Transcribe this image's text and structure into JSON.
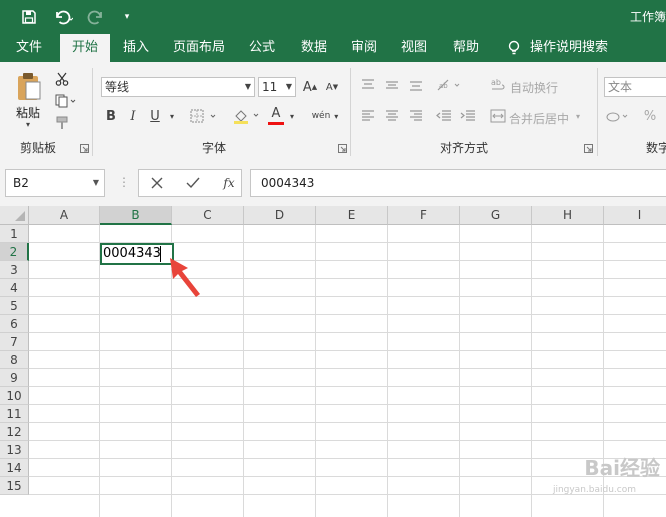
{
  "window": {
    "title": "工作簿"
  },
  "ribbon_tabs": [
    "文件",
    "开始",
    "插入",
    "页面布局",
    "公式",
    "数据",
    "审阅",
    "视图",
    "帮助",
    "操作说明搜索"
  ],
  "clipboard": {
    "paste_label": "粘贴",
    "group_label": "剪贴板"
  },
  "font_group": {
    "font_name": "等线",
    "font_size": "11",
    "bold": "B",
    "italic": "I",
    "underline": "U",
    "font_color_glyph": "A",
    "phonetic_glyph": "wén",
    "group_label": "字体"
  },
  "alignment_group": {
    "wrap_text": "自动换行",
    "merge_center": "合并后居中",
    "group_label": "对齐方式"
  },
  "number_group": {
    "format": "文本",
    "group_label": "数字"
  },
  "formula_bar": {
    "name_box": "B2",
    "fx": "fx",
    "content": "0004343"
  },
  "columns": [
    "A",
    "B",
    "C",
    "D",
    "E",
    "F",
    "G",
    "H",
    "I"
  ],
  "rows": [
    "1",
    "2",
    "3",
    "4",
    "5",
    "6",
    "7",
    "8",
    "9",
    "10",
    "11",
    "12",
    "13",
    "14",
    "15"
  ],
  "active_cell": {
    "ref": "B2",
    "value": "0004343"
  },
  "watermark": {
    "text": "Bai经验",
    "sub": "jingyan.baidu.com"
  },
  "colors": {
    "accent": "#217346",
    "arrow": "#e8443a"
  }
}
